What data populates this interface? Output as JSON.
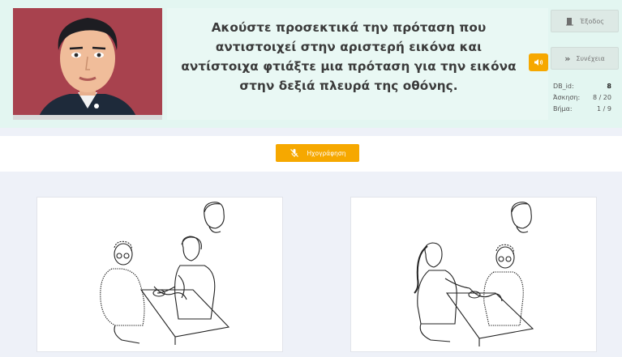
{
  "avatar": {
    "name": "avatar"
  },
  "instruction": "Ακούστε προσεκτικά την πρόταση που αντιστοιχεί στην αριστερή εικόνα και αντίστοιχα φτιάξτε μια πρόταση για την εικόνα στην δεξιά πλευρά της οθόνης.",
  "buttons": {
    "exit_label": "Έξοδος",
    "continue_label": "Συνέχεια",
    "record_label": "Ηχογράφηση"
  },
  "stats": [
    {
      "key": "DB_id:",
      "value": "8"
    },
    {
      "key": "Άσκηση:",
      "value": "8 / 20"
    },
    {
      "key": "Βήμα:",
      "value": "1 / 9"
    }
  ],
  "colors": {
    "accent": "#f6a800",
    "header_bg": "#e3f6f1",
    "avatar_bg": "#a8424e"
  }
}
